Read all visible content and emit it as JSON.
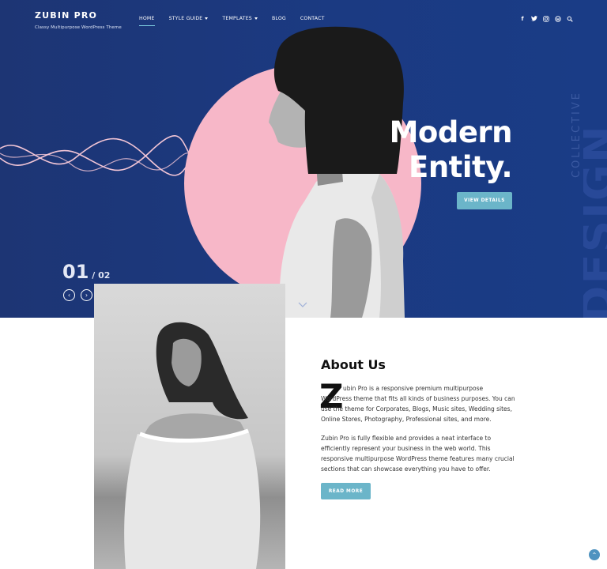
{
  "brand": {
    "name": "ZUBIN PRO",
    "tagline": "Classy Multipurpose WordPress Theme"
  },
  "nav": {
    "items": [
      {
        "label": "HOME",
        "active": true
      },
      {
        "label": "STYLE GUIDE",
        "dropdown": true
      },
      {
        "label": "TEMPLATES",
        "dropdown": true
      },
      {
        "label": "BLOG"
      },
      {
        "label": "CONTACT"
      }
    ]
  },
  "social": {
    "icons": [
      "facebook-icon",
      "twitter-icon",
      "instagram-icon",
      "wordpress-icon",
      "search-icon"
    ],
    "glyphs": [
      "f",
      "t",
      "◎",
      "ⓦ",
      "⌕"
    ]
  },
  "hero": {
    "headline_line1": "Modern",
    "headline_line2": "Entity.",
    "button_label": "VIEW DETAILS",
    "vertical_small": "COLLECTIVE",
    "vertical_large": "DESIGN",
    "slide_current": "01",
    "slide_separator": " / ",
    "slide_total": "02",
    "prev_glyph": "‹",
    "next_glyph": "›"
  },
  "about": {
    "title": "About Us",
    "dropcap": "Z",
    "para1": "ubin Pro is a responsive premium multipurpose WordPress theme that fits all kinds of business purposes. You can use the theme for Corporates, Blogs, Music sites, Wedding sites, Online Stores, Photography, Professional sites, and more.",
    "para2": "Zubin Pro is fully flexible and provides a neat interface to efficiently represent your business in the web world. This responsive multipurpose WordPress theme features many crucial sections that can showcase everything you have to offer.",
    "button_label": "READ MORE"
  },
  "to_top_glyph": "⌃",
  "colors": {
    "hero_bg": "#1b3a82",
    "circle": "#f7b7c8",
    "button": "#6bb5c9",
    "accent_line": "#7fd0e2"
  }
}
